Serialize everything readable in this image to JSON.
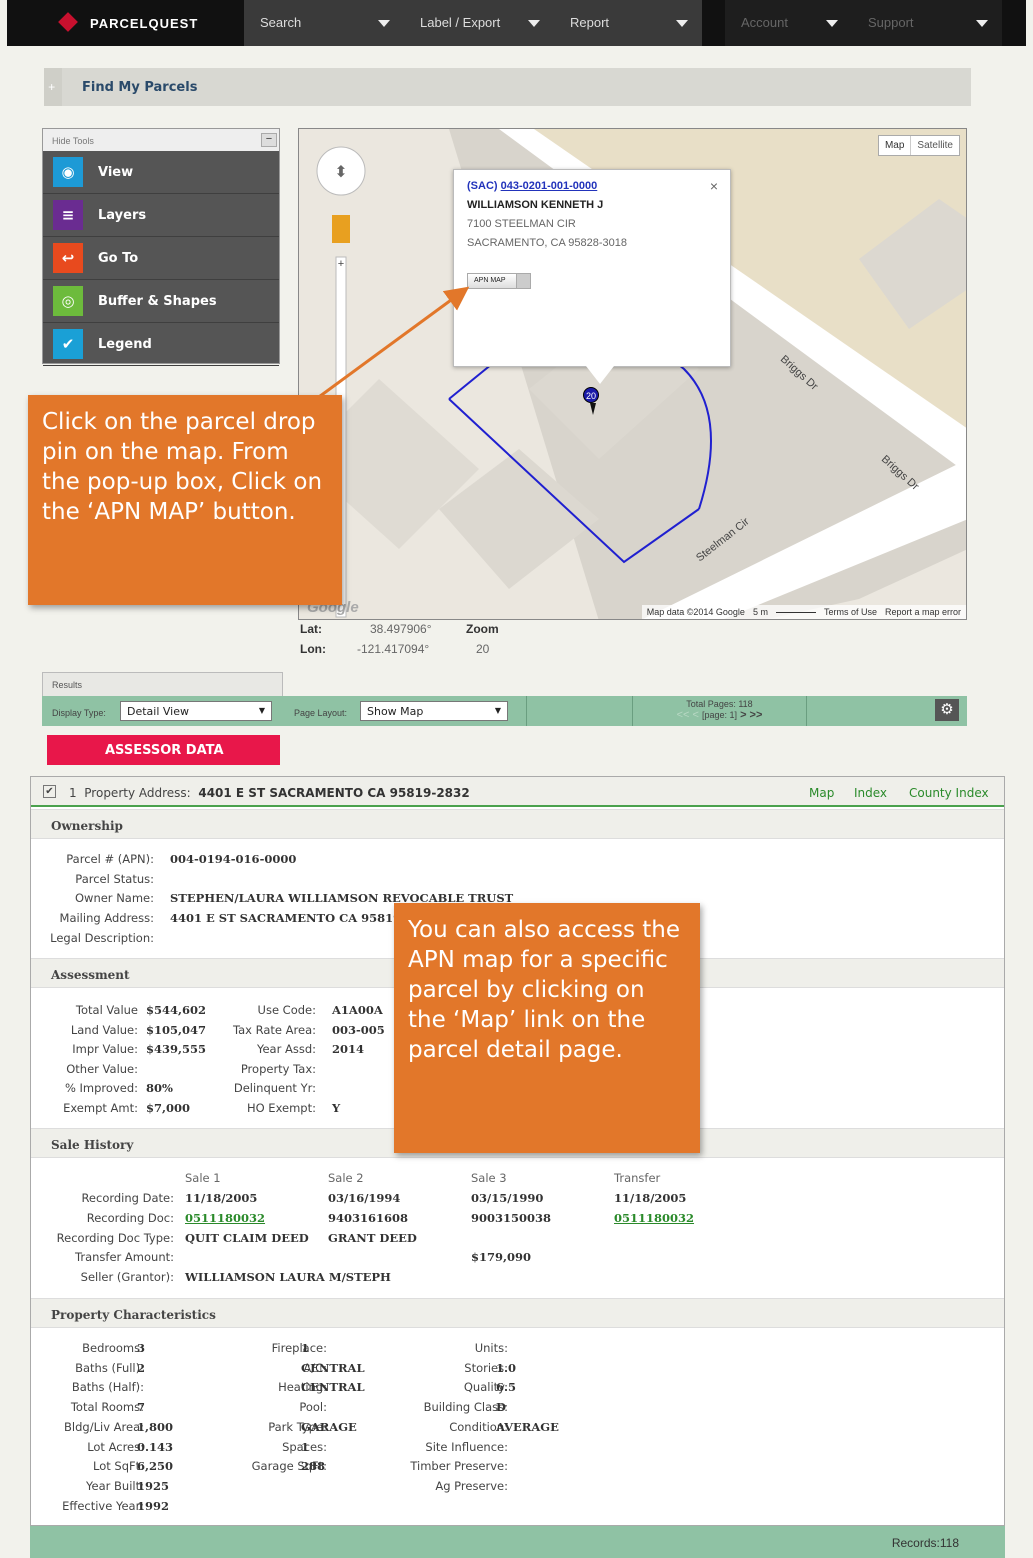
{
  "nav": {
    "brand": "PARCELQUEST",
    "items": [
      "Search",
      "Label / Export",
      "Report",
      "Account",
      "Support"
    ]
  },
  "find": {
    "title": "Find My Parcels"
  },
  "tools": {
    "hide_label": "Hide Tools",
    "min": "−",
    "items": [
      "View",
      "Layers",
      "Go To",
      "Buffer & Shapes",
      "Legend"
    ]
  },
  "map": {
    "type_map": "Map",
    "type_satellite": "Satellite",
    "streets": [
      "Briggs Dr",
      "Briggs Dr",
      "Steelman Cir"
    ],
    "pin": "20",
    "attribution": "Map data ©2014 Google",
    "scale": "5 m",
    "terms": "Terms of Use",
    "report": "Report a map error",
    "google": "Google",
    "popup": {
      "county": "(SAC)",
      "apn": "043-0201-001-0000",
      "owner": "WILLIAMSON KENNETH J",
      "addr1": "7100 STEELMAN CIR",
      "addr2": "SACRAMENTO, CA 95828-3018",
      "btn": "APN MAP",
      "close": "×"
    }
  },
  "latlon": {
    "lat_label": "Lat:",
    "lat": "38.497906°",
    "lon_label": "Lon:",
    "lon": "-121.417094°",
    "zoom_label": "Zoom",
    "zoom": "20"
  },
  "callouts": {
    "one": "Click on the parcel drop pin on the map. From the pop-up box, Click on the ‘APN MAP’ button.",
    "two": "You can also access the APN map for a specific parcel by clicking on the ‘Map’ link on the parcel detail page."
  },
  "results": {
    "tab": "Results",
    "display_label": "Display Type:",
    "display_value": "Detail View",
    "layout_label": "Page Layout:",
    "layout_value": "Show Map",
    "total_pages": "Total Pages: 118",
    "prev": "<< <",
    "page": "[page: 1]",
    "next": "> >>",
    "assessor": "ASSESSOR DATA"
  },
  "detail": {
    "num": "1",
    "addr_label": "Property Address:",
    "addr": "4401 E ST SACRAMENTO CA 95819-2832",
    "links": [
      "Map",
      "Index",
      "County Index"
    ],
    "ownership": {
      "title": "Ownership",
      "apn_label": "Parcel # (APN):",
      "apn": "004-0194-016-0000",
      "status_label": "Parcel Status:",
      "owner_label": "Owner Name:",
      "owner": "STEPHEN/LAURA WILLIAMSON REVOCABLE TRUST",
      "mail_label": "Mailing Address:",
      "mail": "4401 E ST SACRAMENTO CA 95819",
      "legal_label": "Legal Description:"
    },
    "assessment": {
      "title": "Assessment",
      "total_label": "Total Value",
      "total": "$544,602",
      "land_label": "Land Value:",
      "land": "$105,047",
      "impr_label": "Impr Value:",
      "impr": "$439,555",
      "other_label": "Other Value:",
      "pct_label": "% Improved:",
      "pct": "80%",
      "exempt_label": "Exempt Amt:",
      "exempt": "$7,000",
      "use_label": "Use Code:",
      "use": "A1A00A",
      "tra_label": "Tax Rate Area:",
      "tra": "003-005",
      "yr_label": "Year Assd:",
      "yr": "2014",
      "ptax_label": "Property Tax:",
      "delinq_label": "Delinquent Yr:",
      "ho_label": "HO Exempt:",
      "ho": "Y"
    },
    "sale": {
      "title": "Sale History",
      "cols": [
        "Sale 1",
        "Sale 2",
        "Sale 3",
        "Transfer"
      ],
      "rec_date_label": "Recording Date:",
      "rec_dates": [
        "11/18/2005",
        "03/16/1994",
        "03/15/1990",
        "11/18/2005"
      ],
      "rec_doc_label": "Recording Doc:",
      "rec_docs": [
        "0511180032",
        "9403161608",
        "9003150038",
        "0511180032"
      ],
      "doc_type_label": "Recording Doc Type:",
      "doc_types": [
        "QUIT CLAIM DEED",
        "GRANT DEED"
      ],
      "amount_label": "Transfer Amount:",
      "amount3": "$179,090",
      "seller_label": "Seller (Grantor):",
      "seller": "WILLIAMSON LAURA M/STEPH"
    },
    "chars": {
      "title": "Property Characteristics",
      "c1": [
        [
          "Bedrooms:",
          "3"
        ],
        [
          "Baths (Full):",
          "2"
        ],
        [
          "Baths (Half):",
          ""
        ],
        [
          "Total Rooms:",
          "7"
        ],
        [
          "Bldg/Liv Area:",
          "1,800"
        ],
        [
          "Lot Acres:",
          "0.143"
        ],
        [
          "Lot SqFt:",
          "6,250"
        ],
        [
          "Year Built:",
          "1925"
        ],
        [
          "Effective Year:",
          "1992"
        ]
      ],
      "c2": [
        [
          "Fireplace:",
          "1"
        ],
        [
          "A/C:",
          "CENTRAL"
        ],
        [
          "Heating:",
          "CENTRAL"
        ],
        [
          "Pool:",
          ""
        ],
        [
          "Park Type:",
          "GARAGE"
        ],
        [
          "Spaces:",
          "1"
        ],
        [
          "Garage SqFt:",
          "288"
        ]
      ],
      "c3": [
        [
          "Units:",
          ""
        ],
        [
          "Stories:",
          "1.0"
        ],
        [
          "Quality:",
          "6.5"
        ],
        [
          "Building Class:",
          "D"
        ],
        [
          "Condition:",
          "AVERAGE"
        ],
        [
          "Site Influence:",
          ""
        ],
        [
          "Timber Preserve:",
          ""
        ],
        [
          "Ag Preserve:",
          ""
        ]
      ]
    }
  },
  "footer": {
    "records": "Records:118"
  }
}
